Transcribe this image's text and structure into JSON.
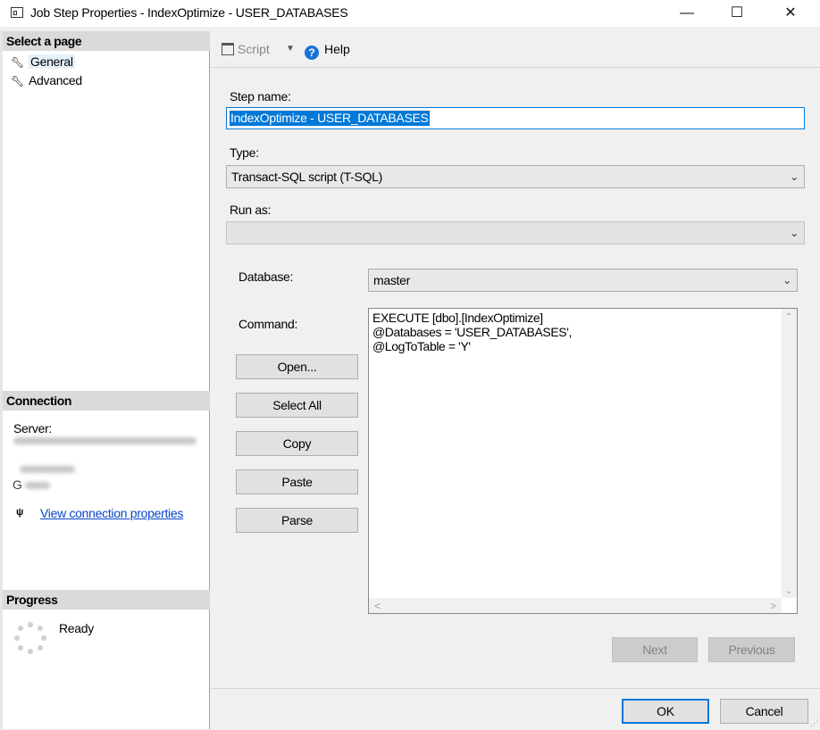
{
  "window": {
    "title": "Job Step Properties - IndexOptimize - USER_DATABASES",
    "minimize": "—",
    "maximize": "☐",
    "close": "✕"
  },
  "left_panel": {
    "select_page_header": "Select a page",
    "pages": [
      {
        "label": "General",
        "icon": "wrench-icon",
        "selected": true
      },
      {
        "label": "Advanced",
        "icon": "wrench-icon",
        "selected": false
      }
    ],
    "connection_header": "Connection",
    "server_label": "Server:",
    "connection_label_partial": "G",
    "view_connection_link": "View connection properties",
    "progress_header": "Progress",
    "progress_status": "Ready"
  },
  "toolbar": {
    "script_label": "Script",
    "help_label": "Help"
  },
  "form": {
    "step_name_label": "Step name:",
    "step_name_value": "IndexOptimize - USER_DATABASES",
    "type_label": "Type:",
    "type_value": "Transact-SQL script (T-SQL)",
    "run_as_label": "Run as:",
    "run_as_value": "",
    "database_label": "Database:",
    "database_value": "master",
    "command_label": "Command:",
    "command_lines": [
      "EXECUTE [dbo].[IndexOptimize]",
      "@Databases = 'USER_DATABASES',",
      "@LogToTable = 'Y'"
    ],
    "buttons": {
      "open": "Open...",
      "select_all": "Select All",
      "copy": "Copy",
      "paste": "Paste",
      "parse": "Parse"
    },
    "next": "Next",
    "previous": "Previous"
  },
  "footer": {
    "ok": "OK",
    "cancel": "Cancel"
  },
  "colors": {
    "accent": "#0078d7",
    "link": "#0645c9",
    "header_bg": "#dadada"
  }
}
